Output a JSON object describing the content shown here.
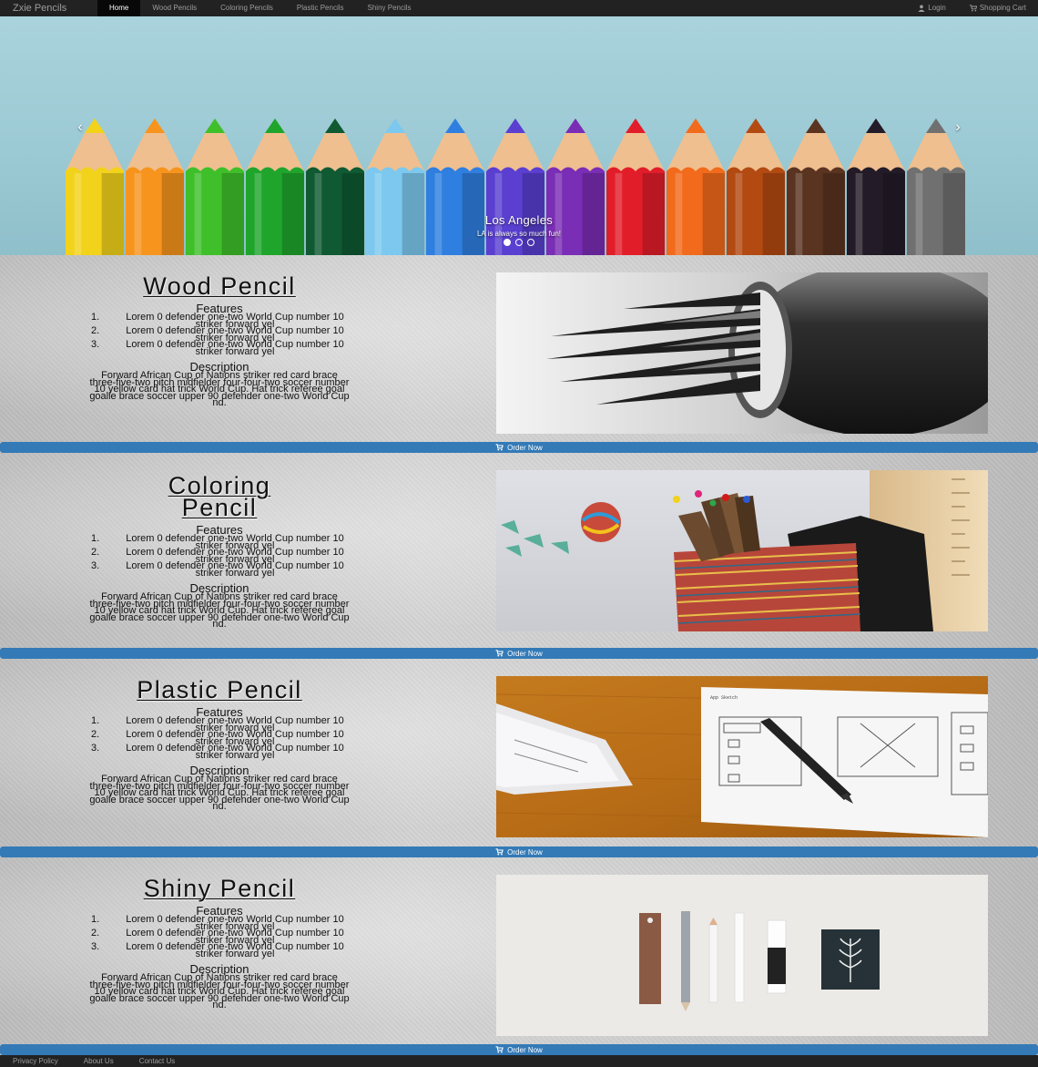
{
  "navbar": {
    "brand": "Zxie Pencils",
    "items": [
      {
        "label": "Home",
        "active": true
      },
      {
        "label": "Wood Pencils",
        "active": false
      },
      {
        "label": "Coloring Pencils",
        "active": false
      },
      {
        "label": "Plastic Pencils",
        "active": false
      },
      {
        "label": "Shiny Pencils",
        "active": false
      }
    ],
    "login_label": "Login",
    "cart_label": "Shopping Cart"
  },
  "carousel": {
    "caption_title": "Los Angeles",
    "caption_text": "LA is always so much fun!",
    "slide_count": 3,
    "active_slide": 1,
    "pencil_colors": [
      "#f2d21a",
      "#f7941d",
      "#3fbf2a",
      "#1fa52c",
      "#0f5a33",
      "#7cc8ee",
      "#2f7fe0",
      "#5a3fd1",
      "#7a2db5",
      "#e21d2a",
      "#f26a1b",
      "#b24a12",
      "#5a3420",
      "#231b28",
      "#707070"
    ]
  },
  "products": [
    {
      "title": "Wood Pencil",
      "features_heading": "Features",
      "features": [
        "Lorem 0 defender one-two World Cup number 10 striker forward yel",
        "Lorem 0 defender one-two World Cup number 10 striker forward yel",
        "Lorem 0 defender one-two World Cup number 10 striker forward yel"
      ],
      "description_heading": "Description",
      "description": "Forward African Cup of Nations striker red card brace three-five-two pitch midfielder four-four-two soccer number 10 yellow card hat trick World Cup. Hat trick referee goal goalie brace soccer upper 90 defender one-two World Cup nd.",
      "order_label": "Order Now"
    },
    {
      "title": "Coloring Pencil",
      "features_heading": "Features",
      "features": [
        "Lorem 0 defender one-two World Cup number 10 striker forward yel",
        "Lorem 0 defender one-two World Cup number 10 striker forward yel",
        "Lorem 0 defender one-two World Cup number 10 striker forward yel"
      ],
      "description_heading": "Description",
      "description": "Forward African Cup of Nations striker red card brace three-five-two pitch midfielder four-four-two soccer number 10 yellow card hat trick World Cup. Hat trick referee goal goalie brace soccer upper 90 defender one-two World Cup nd.",
      "order_label": "Order Now"
    },
    {
      "title": "Plastic Pencil",
      "features_heading": "Features",
      "features": [
        "Lorem 0 defender one-two World Cup number 10 striker forward yel",
        "Lorem 0 defender one-two World Cup number 10 striker forward yel",
        "Lorem 0 defender one-two World Cup number 10 striker forward yel"
      ],
      "description_heading": "Description",
      "description": "Forward African Cup of Nations striker red card brace three-five-two pitch midfielder four-four-two soccer number 10 yellow card hat trick World Cup. Hat trick referee goal goalie brace soccer upper 90 defender one-two World Cup nd.",
      "order_label": "Order Now"
    },
    {
      "title": "Shiny Pencil",
      "features_heading": "Features",
      "features": [
        "Lorem 0 defender one-two World Cup number 10 striker forward yel",
        "Lorem 0 defender one-two World Cup number 10 striker forward yel",
        "Lorem 0 defender one-two World Cup number 10 striker forward yel"
      ],
      "description_heading": "Description",
      "description": "Forward African Cup of Nations striker red card brace three-five-two pitch midfielder four-four-two soccer number 10 yellow card hat trick World Cup. Hat trick referee goal goalie brace soccer upper 90 defender one-two World Cup nd.",
      "order_label": "Order Now"
    }
  ],
  "footer": {
    "links": [
      "Privacy Policy",
      "About Us",
      "Contact Us"
    ]
  },
  "colors": {
    "navbar_bg": "#222222",
    "order_bar": "#337ab7",
    "carousel_sky": "#9ccad4"
  }
}
